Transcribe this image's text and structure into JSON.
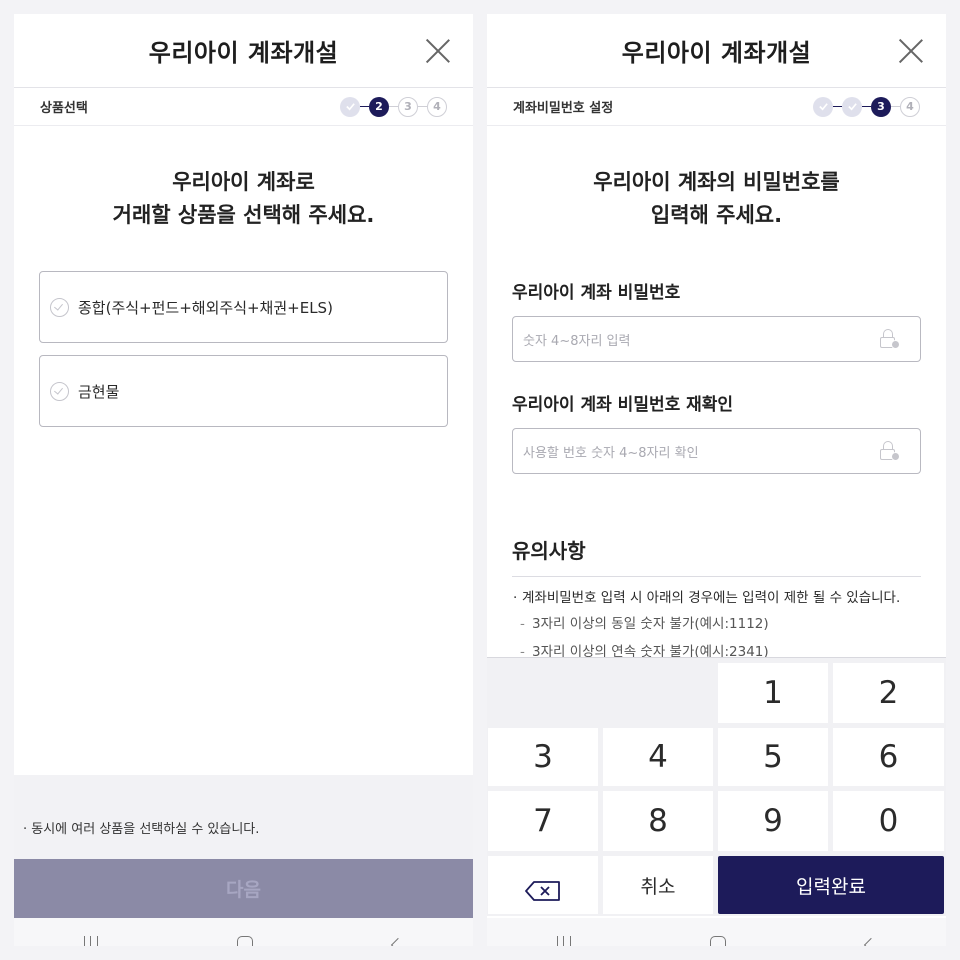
{
  "left": {
    "header_title": "우리아이 계좌개설",
    "step_label": "상품선택",
    "steps": [
      "2",
      "3",
      "4"
    ],
    "heading_line1": "우리아이 계좌로",
    "heading_line2": "거래할 상품을 선택해 주세요.",
    "options": [
      "종합(주식+펀드+해외주식+채권+ELS)",
      "금현물"
    ],
    "notice": "· 동시에 여러 상품을 선택하실 수 있습니다.",
    "next_label": "다음"
  },
  "right": {
    "header_title": "우리아이 계좌개설",
    "step_label": "계좌비밀번호 설정",
    "steps": [
      "3",
      "4"
    ],
    "heading_line1": "우리아이 계좌의 비밀번호를",
    "heading_line2": "입력해 주세요.",
    "field1": {
      "label": "우리아이 계좌 비밀번호",
      "placeholder": "숫자 4~8자리 입력"
    },
    "field2": {
      "label": "우리아이 계좌 비밀번호 재확인",
      "placeholder": "사용할 번호 숫자 4~8자리 확인"
    },
    "caution_title": "유의사항",
    "caution_main": "계좌비밀번호 입력 시 아래의 경우에는 입력이 제한 될 수 있습니다.",
    "caution_subs": [
      "3자리 이상의 동일 숫자 불가(예시:1112)",
      "3자리 이상의 연속 숫자 불가(예시:2341)"
    ],
    "keypad": {
      "keys": [
        "1",
        "2",
        "3",
        "4",
        "5",
        "6",
        "7",
        "8",
        "9",
        "0"
      ],
      "cancel": "취소",
      "done": "입력완료"
    }
  },
  "colors": {
    "primary": "#1d1b5a",
    "disabled_button": "#8b8aa6"
  },
  "icons": [
    "close-icon",
    "check-icon",
    "lock-icon",
    "backspace-icon"
  ]
}
